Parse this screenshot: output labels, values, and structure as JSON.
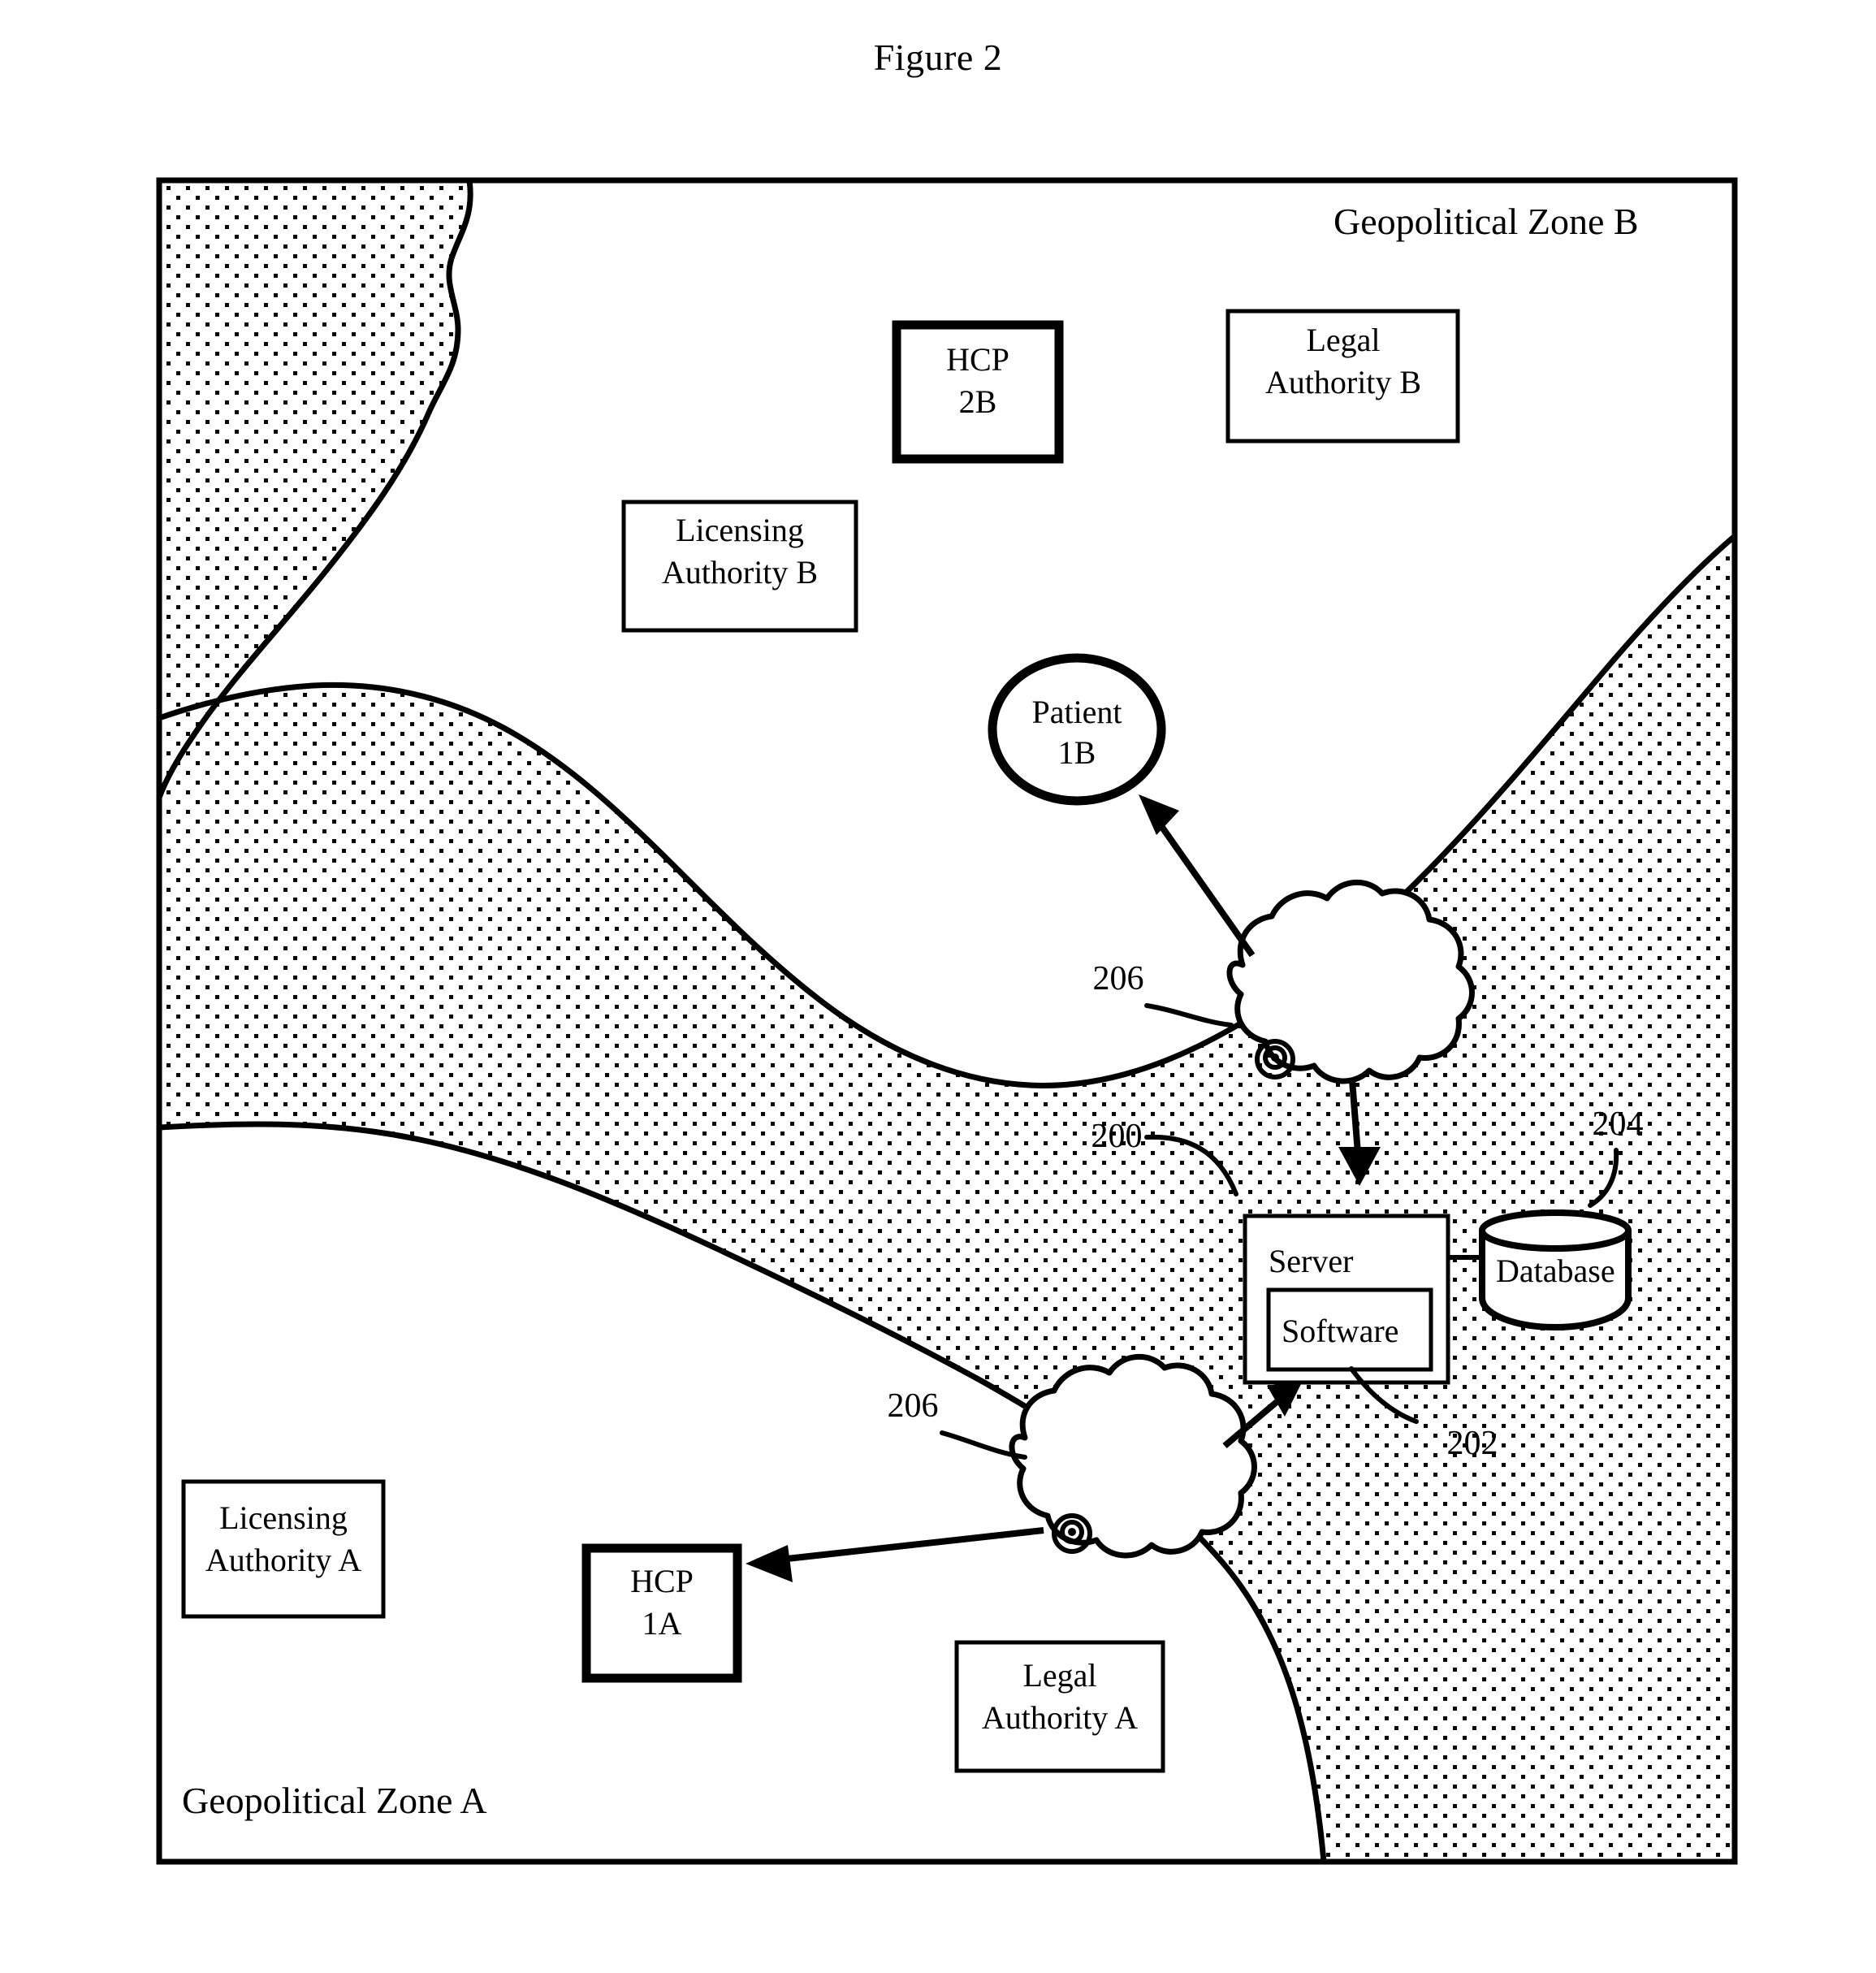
{
  "figure": {
    "title": "Figure 2"
  },
  "zones": {
    "zone_b_label": "Geopolitical Zone B",
    "zone_a_label": "Geopolitical Zone A"
  },
  "nodes": {
    "hcp_2b": {
      "line1": "HCP",
      "line2": "2B"
    },
    "legal_authority_b": {
      "line1": "Legal",
      "line2": "Authority B"
    },
    "licensing_authority_b": {
      "line1": "Licensing",
      "line2": "Authority B"
    },
    "patient_1b": {
      "line1": "Patient",
      "line2": "1B"
    },
    "server": {
      "label": "Server"
    },
    "software": {
      "label": "Software"
    },
    "database": {
      "label": "Database"
    },
    "licensing_authority_a": {
      "line1": "Licensing",
      "line2": "Authority A"
    },
    "hcp_1a": {
      "line1": "HCP",
      "line2": "1A"
    },
    "legal_authority_a": {
      "line1": "Legal",
      "line2": "Authority A"
    }
  },
  "reference_numerals": {
    "network_upper": "206",
    "network_lower": "206",
    "server_ref": "200",
    "database_ref": "204",
    "software_ref": "202"
  },
  "colors": {
    "ink": "#000000",
    "paper": "#ffffff"
  }
}
